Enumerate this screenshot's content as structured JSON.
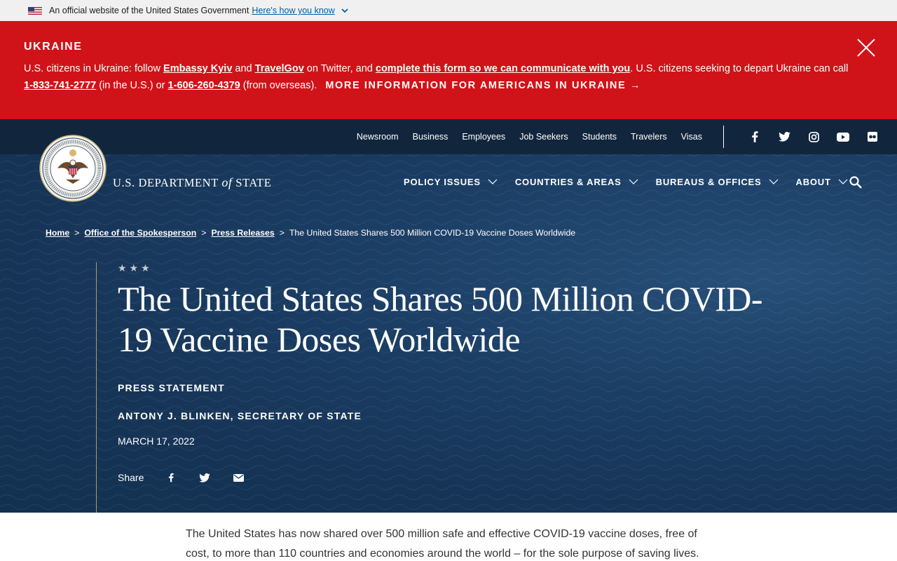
{
  "gov_banner": {
    "text": "An official website of the United States Government",
    "link": "Here's how you know"
  },
  "alert": {
    "title": "UKRAINE",
    "t1": "U.S. citizens in Ukraine: follow ",
    "link1": "Embassy Kyiv",
    "t2": " and ",
    "link2": "TravelGov",
    "t3": " on Twitter, and ",
    "link3": "complete this form so we can communicate with you",
    "t4": ". U.S. citizens seeking to depart Ukraine can call ",
    "phone1": "1-833-741-2777",
    "t5": " (in the U.S.) or ",
    "phone2": "1-606-260-4379",
    "t6": " (from overseas).",
    "more": "MORE INFORMATION FOR AMERICANS IN UKRAINE →"
  },
  "utility_links": [
    "Newsroom",
    "Business",
    "Employees",
    "Job Seekers",
    "Students",
    "Travelers",
    "Visas"
  ],
  "social_icons": [
    "facebook-icon",
    "twitter-icon",
    "instagram-icon",
    "youtube-icon",
    "flickr-icon"
  ],
  "dept": {
    "name_a": "U.S. DEPARTMENT ",
    "name_b": "of",
    "name_c": " STATE"
  },
  "main_nav": [
    "POLICY ISSUES",
    "COUNTRIES & AREAS",
    "BUREAUS & OFFICES",
    "ABOUT"
  ],
  "breadcrumb": {
    "home": "Home",
    "office": "Office of the Spokesperson",
    "press": "Press Releases",
    "current": "The United States Shares 500 Million COVID-19 Vaccine Doses Worldwide",
    "sep": ">"
  },
  "article": {
    "stars": "★★★",
    "title": "The United States Shares 500 Million COVID-19 Vaccine Doses Worldwide",
    "type": "PRESS STATEMENT",
    "author": "ANTONY J. BLINKEN, SECRETARY OF STATE",
    "date": "MARCH 17, 2022",
    "share_label": "Share",
    "body": "The United States has now shared over 500 million safe and effective COVID-19 vaccine doses, free of cost, to more than 110 countries and economies around the world – for the sole purpose of saving lives."
  },
  "colors": {
    "alert_red": "#d01319",
    "hero_navy": "#1c3f66",
    "utility_bar": "#11263d",
    "gold_rule": "#b99a5e"
  }
}
